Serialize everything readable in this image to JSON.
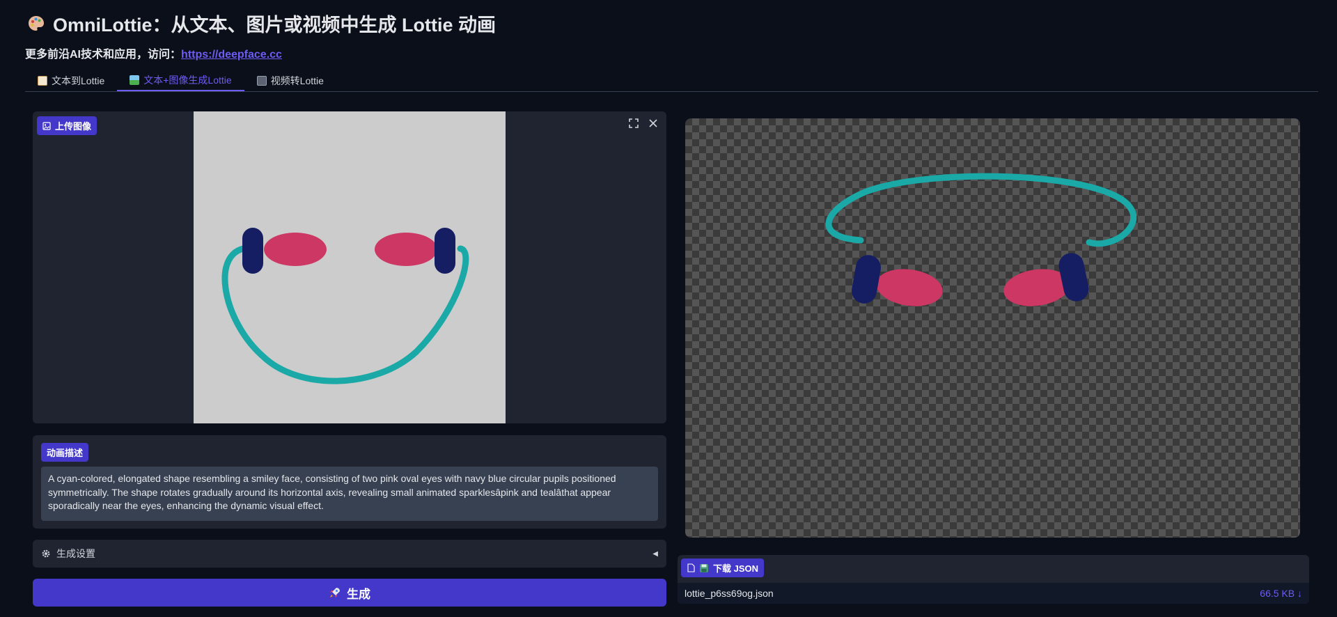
{
  "header": {
    "title": "OmniLottie：从文本、图片或视频中生成 Lottie 动画",
    "subtitle_prefix": "更多前沿AI技术和应用，访问：",
    "subtitle_link": "https://deepface.cc"
  },
  "tabs": [
    {
      "label": "文本到Lottie",
      "icon": "document-icon"
    },
    {
      "label": "文本+图像生成Lottie",
      "icon": "image-icon",
      "active": true
    },
    {
      "label": "视频转Lottie",
      "icon": "film-icon"
    }
  ],
  "upload": {
    "label": "上传图像"
  },
  "description": {
    "label": "动画描述",
    "value": "A cyan-colored, elongated shape resembling a smiley face, consisting of two pink oval eyes with navy blue circular pupils positioned symmetrically. The shape rotates gradually around its horizontal axis, revealing small animated sparklesâpink and tealâthat appear sporadically near the eyes, enhancing the dynamic visual effect."
  },
  "settings": {
    "label": "生成设置"
  },
  "generate": {
    "label": "生成"
  },
  "download": {
    "label": "下载 JSON",
    "filename": "lottie_p6ss69og.json",
    "size": "66.5 KB ↓"
  },
  "colors": {
    "accent": "#4338ca",
    "teal": "#1aa9a6",
    "pink": "#cc3763",
    "navy": "#151d63"
  }
}
